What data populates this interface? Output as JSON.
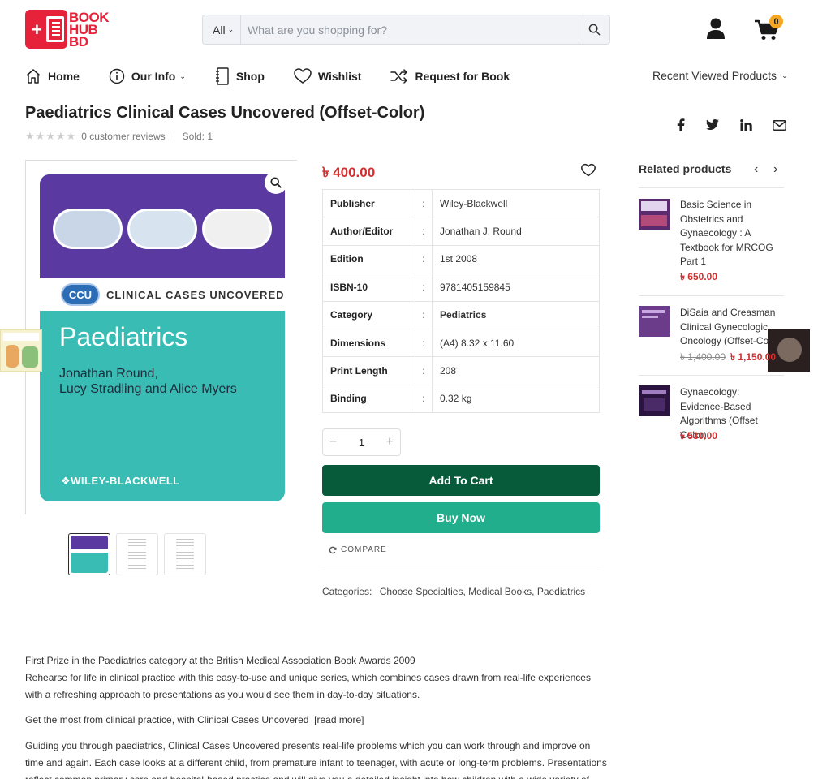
{
  "header": {
    "logo_text": [
      "BOOK",
      "HUB",
      "BD"
    ],
    "search": {
      "category": "All",
      "placeholder": "What are you shopping for?"
    },
    "cart_count": "0"
  },
  "nav": {
    "items": [
      {
        "label": "Home",
        "icon": "home-icon"
      },
      {
        "label": "Our Info",
        "icon": "info-icon",
        "dropdown": true
      },
      {
        "label": "Shop",
        "icon": "notebook-icon"
      },
      {
        "label": "Wishlist",
        "icon": "heart-icon"
      },
      {
        "label": "Request for Book",
        "icon": "shuffle-icon"
      }
    ],
    "recent": "Recent Viewed Products"
  },
  "product": {
    "title": "Paediatrics Clinical Cases Uncovered (Offset-Color)",
    "rating": 0,
    "reviews": "0 customer reviews",
    "sold": "Sold: 1",
    "price": "৳ 400.00",
    "cover": {
      "series_badge": "CCU",
      "series": "CLINICAL CASES UNCOVERED",
      "title": "Paediatrics",
      "authors_line1": "Jonathan Round,",
      "authors_line2": "Lucy Stradling and Alice Myers",
      "publisher": "WILEY-BLACKWELL"
    },
    "specs": [
      {
        "key": "Publisher",
        "value": "Wiley-Blackwell",
        "bold": false
      },
      {
        "key": "Author/Editor",
        "value": "Jonathan J. Round",
        "bold": false
      },
      {
        "key": "Edition",
        "value": "1st 2008",
        "bold": false
      },
      {
        "key": "ISBN-10",
        "value": "9781405159845",
        "bold": false
      },
      {
        "key": "Category",
        "value": "Pediatrics",
        "bold": true
      },
      {
        "key": "Dimensions",
        "value": "(A4) 8.32 x 11.60",
        "bold": false
      },
      {
        "key": "Print Length",
        "value": "208",
        "bold": false
      },
      {
        "key": "Binding",
        "value": "0.32 kg",
        "bold": false
      }
    ],
    "quantity": "1",
    "add_to_cart": "Add To Cart",
    "buy_now": "Buy Now",
    "compare": "COMPARE",
    "categories_label": "Categories:",
    "categories": "Choose Specialties, Medical Books, Paediatrics"
  },
  "related": {
    "title": "Related products",
    "items": [
      {
        "name": "Basic Science in Obstetrics and Gynaecology : A Textbook for MRCOG Part 1",
        "price": "৳ 650.00",
        "old_price": ""
      },
      {
        "name": "DiSaia and Creasman Clinical Gynecologic Oncology (Offset-Co",
        "price": "৳ 1,150.00",
        "old_price": "৳ 1,400.00"
      },
      {
        "name": "Gynaecology: Evidence-Based Algorithms (Offset Color)",
        "price": "৳ 530.00",
        "old_price": ""
      }
    ]
  },
  "description": {
    "p1_line1": "First Prize in the Paediatrics category at the British Medical Association Book Awards 2009",
    "p1_rest": "Rehearse for life in clinical practice with this easy-to-use and unique series, which combines cases drawn from real-life experiences with a refreshing approach to presentations as you would see them in day-to-day situations.",
    "p2": "Get the most from clinical practice, with Clinical Cases Uncovered",
    "read_more": "[read more]",
    "p3": "Guiding you through paediatrics, Clinical Cases Uncovered presents real-life problems which you can work through and improve on time and again. Each case looks at a different child, from premature infant to teenager, with acute or long-term problems. Presentations reflect common primary care and hospital-based practice and will give you a detailed insight into how children with a wide variety of"
  },
  "colors": {
    "brand": "#e6223a",
    "price": "#d32f2f",
    "add_to_cart": "#075a3a",
    "buy_now": "#21ae8c",
    "cart_badge": "#f5a623"
  }
}
